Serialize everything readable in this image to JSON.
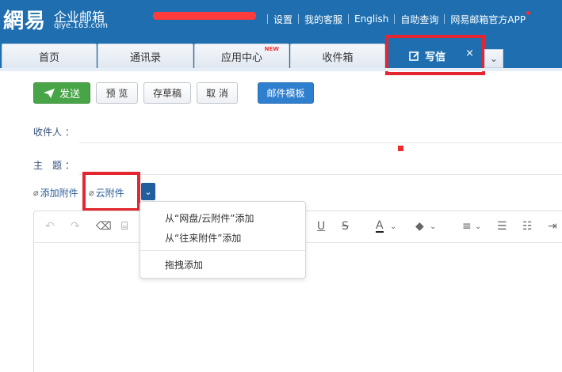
{
  "brand": {
    "logo_text": "網易",
    "product": "企业邮箱",
    "domain": "qiye.163.com"
  },
  "top_links": [
    "设置",
    "我的客服",
    "English",
    "自助查询",
    "网易邮箱官方APP"
  ],
  "tabs": [
    {
      "label": "首页"
    },
    {
      "label": "通讯录"
    },
    {
      "label": "应用中心",
      "badge": "NEW"
    },
    {
      "label": "收件箱"
    }
  ],
  "active_tab": {
    "label": "写信",
    "close": "×"
  },
  "toolbar": {
    "send": "发送",
    "preview": "预 览",
    "save_draft": "存草稿",
    "cancel": "取 消",
    "template": "邮件模板"
  },
  "fields": {
    "recipient_label": "收件人 ：",
    "subject_label": "主　题 ："
  },
  "attachments": {
    "add": "添加附件",
    "cloud": "云附件"
  },
  "attach_menu": {
    "items": [
      "从“网盘/云附件”添加",
      "从“往来附件”添加",
      "拖拽添加"
    ]
  },
  "editor_tools": [
    "undo-icon",
    "redo-icon",
    "eraser-icon",
    "format-painter-icon",
    "underline-icon",
    "strikethrough-icon",
    "font-color-icon",
    "highlight-icon",
    "align-icon",
    "bullet-list-icon",
    "numbered-list-icon",
    "indent-icon"
  ],
  "colors": {
    "header_blue": "#1f6fb0",
    "send_green": "#47a447",
    "template_blue": "#2f7fcf",
    "highlight_red": "#e3262f"
  }
}
